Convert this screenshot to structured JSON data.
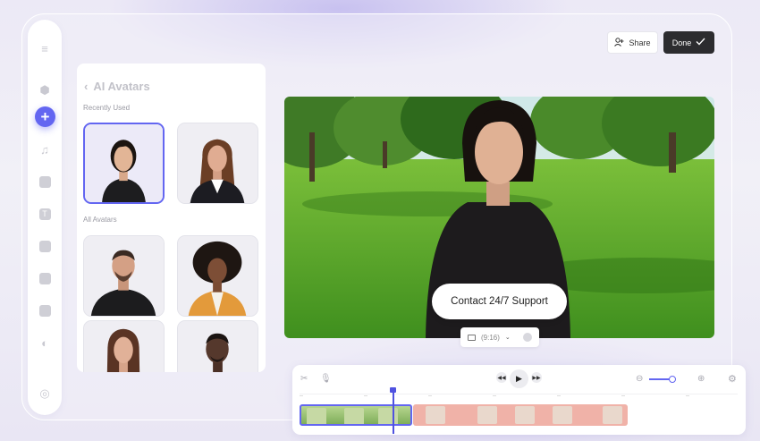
{
  "header": {
    "share_label": "Share",
    "done_label": "Done"
  },
  "panel": {
    "title": "AI Avatars",
    "recently_used_label": "Recently Used",
    "all_avatars_label": "All Avatars"
  },
  "video": {
    "cta_label": "Contact 24/7 Support",
    "aspect_ratio": "(9:16)"
  },
  "sidebar": {
    "icons": [
      "menu-icon",
      "hexagon-icon",
      "add-icon",
      "music-icon",
      "subtitle-icon",
      "text-icon",
      "sticker-icon",
      "video-icon",
      "media-icon",
      "filter-icon",
      "settings-icon"
    ]
  },
  "timeline": {
    "zoom_level": 0.9
  },
  "colors": {
    "accent": "#6366f1",
    "done_bg": "#2c2c2f",
    "clip_audio": "#f0b2a8"
  }
}
